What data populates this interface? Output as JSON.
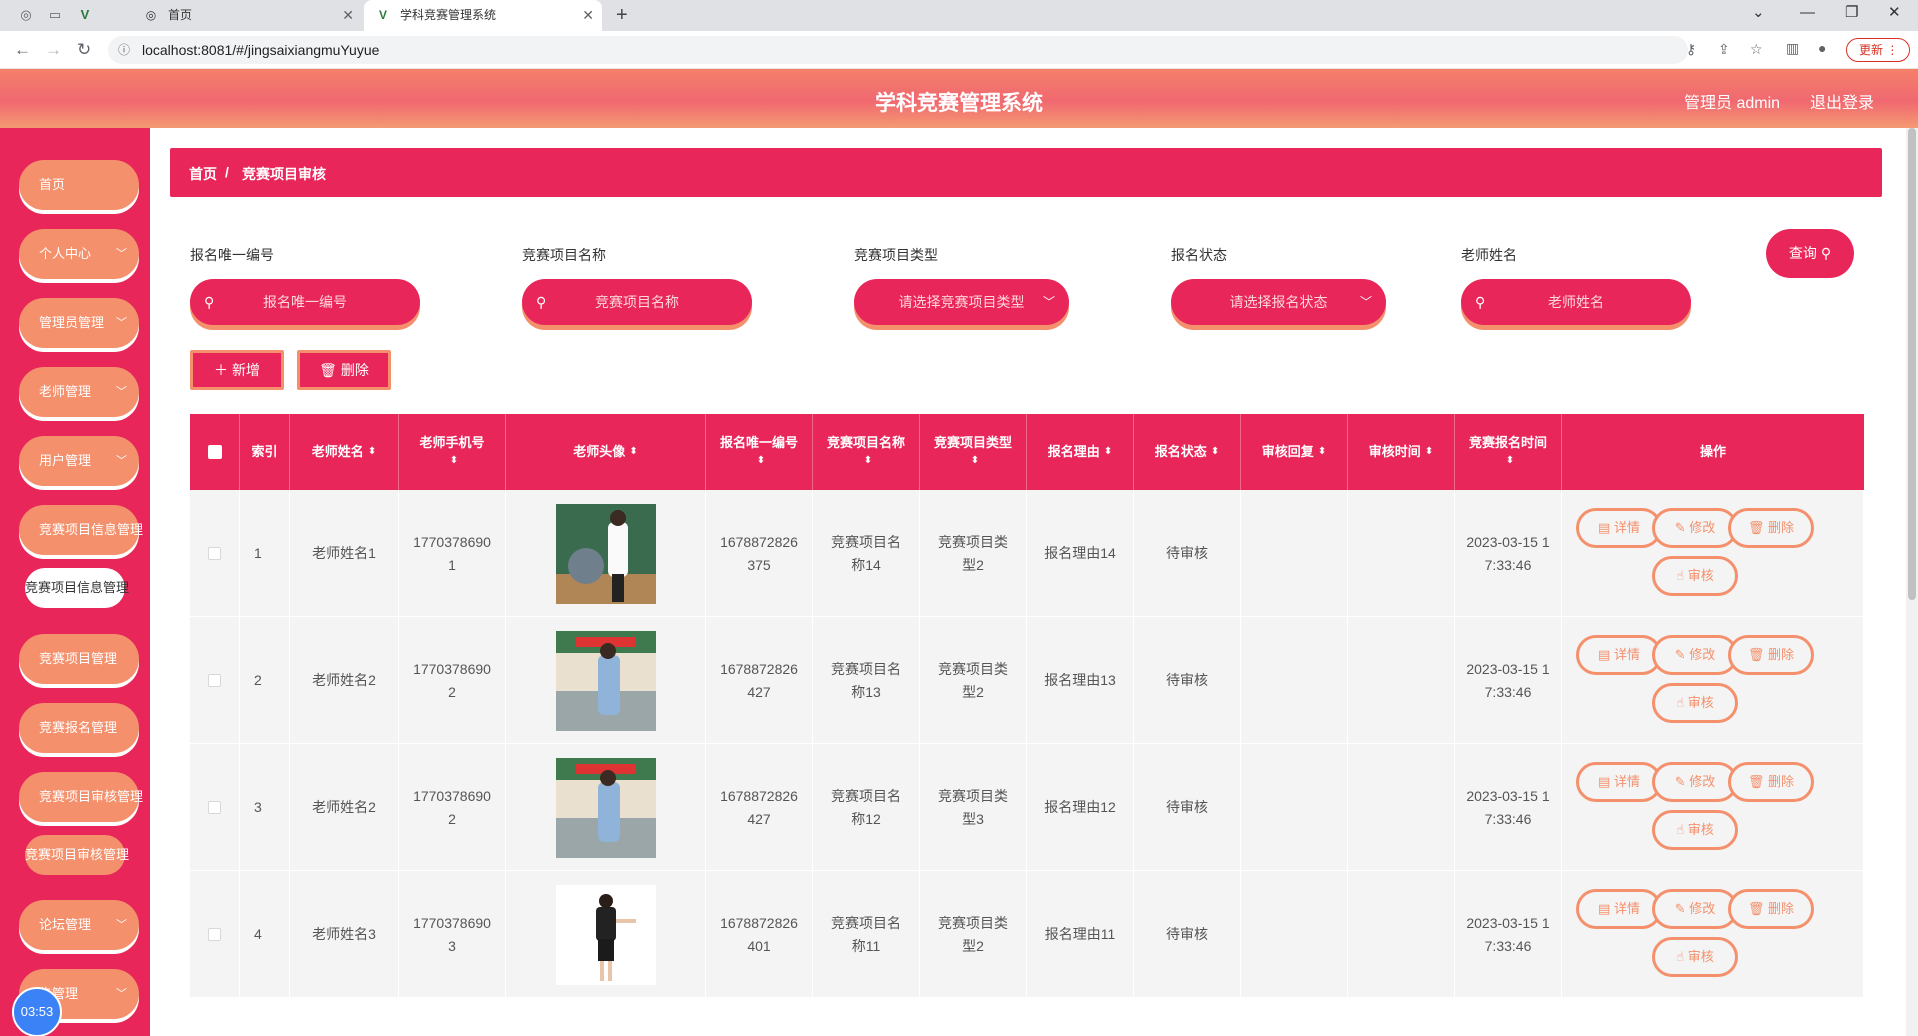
{
  "browser": {
    "tabs": [
      {
        "title": "首页"
      },
      {
        "title": "学科竞赛管理系统"
      }
    ],
    "url": "localhost:8081/#/jingsaixiangmuYuyue",
    "update_label": "更新"
  },
  "header": {
    "title": "学科竞赛管理系统",
    "user": "管理员 admin",
    "logout": "退出登录"
  },
  "sidebar": {
    "items": [
      {
        "label": "首页"
      },
      {
        "label": "个人中心"
      },
      {
        "label": "管理员管理"
      },
      {
        "label": "老师管理"
      },
      {
        "label": "用户管理"
      },
      {
        "label": "竞赛项目信息管理"
      },
      {
        "label": "竞赛项目信息管理"
      },
      {
        "label": "竞赛项目管理"
      },
      {
        "label": "竞赛报名管理"
      },
      {
        "label": "竞赛项目审核管理"
      },
      {
        "label": "竞赛项目审核管理"
      },
      {
        "label": "论坛管理"
      },
      {
        "label": "告管理"
      }
    ],
    "clock": "03:53"
  },
  "breadcrumb": {
    "home": "首页",
    "sep": "/",
    "current": "竞赛项目审核"
  },
  "filters": [
    {
      "label": "报名唯一编号",
      "placeholder": "报名唯一编号"
    },
    {
      "label": "竞赛项目名称",
      "placeholder": "竞赛项目名称"
    },
    {
      "label": "竞赛项目类型",
      "placeholder": "请选择竞赛项目类型"
    },
    {
      "label": "报名状态",
      "placeholder": "请选择报名状态"
    },
    {
      "label": "老师姓名",
      "placeholder": "老师姓名"
    }
  ],
  "search_label": "查询",
  "actions": {
    "add": "新增",
    "delete": "删除"
  },
  "table": {
    "headers": [
      "索引",
      "老师姓名",
      "老师手机号",
      "老师头像",
      "报名唯一编号",
      "竞赛项目名称",
      "竞赛项目类型",
      "报名理由",
      "报名状态",
      "审核回复",
      "审核时间",
      "竞赛报名时间",
      "操作"
    ],
    "rows": [
      {
        "index": "1",
        "name": "老师姓名1",
        "phone": "17703786901",
        "code": "1678872826375",
        "project": "竞赛项目名称14",
        "type": "竞赛项目类型2",
        "reason": "报名理由14",
        "status": "待审核",
        "reply": "",
        "audit_time": "",
        "time": "2023-03-15 17:33:46"
      },
      {
        "index": "2",
        "name": "老师姓名2",
        "phone": "17703786902",
        "code": "1678872826427",
        "project": "竞赛项目名称13",
        "type": "竞赛项目类型2",
        "reason": "报名理由13",
        "status": "待审核",
        "reply": "",
        "audit_time": "",
        "time": "2023-03-15 17:33:46"
      },
      {
        "index": "3",
        "name": "老师姓名2",
        "phone": "17703786902",
        "code": "1678872826427",
        "project": "竞赛项目名称12",
        "type": "竞赛项目类型3",
        "reason": "报名理由12",
        "status": "待审核",
        "reply": "",
        "audit_time": "",
        "time": "2023-03-15 17:33:46"
      },
      {
        "index": "4",
        "name": "老师姓名3",
        "phone": "17703786903",
        "code": "1678872826401",
        "project": "竞赛项目名称11",
        "type": "竞赛项目类型2",
        "reason": "报名理由11",
        "status": "待审核",
        "reply": "",
        "audit_time": "",
        "time": "2023-03-15 17:33:46"
      }
    ],
    "op_labels": {
      "detail": "详情",
      "edit": "修改",
      "delete": "删除",
      "audit": "审核"
    }
  },
  "colors": {
    "primary": "#e8265a",
    "accent": "#f4906c"
  }
}
